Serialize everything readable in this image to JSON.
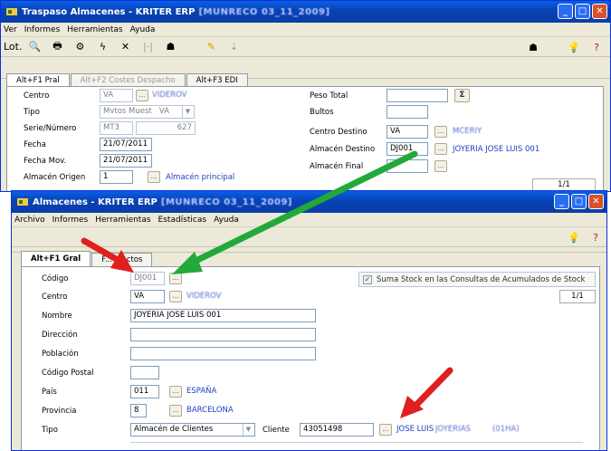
{
  "window1": {
    "title": "Traspaso Almacenes - KRITER ERP",
    "title_blur": "[MUNRECO 03_11_2009]",
    "menu": [
      "Ver",
      "Informes",
      "Herramientas",
      "Ayuda"
    ],
    "toolbar_label": "Lot.",
    "tabs": [
      "Alt+F1 Pral",
      "Alt+F2 Costes Despacho",
      "Alt+F3 EDI"
    ],
    "fields": {
      "centro_label": "Centro",
      "centro_value": "VA",
      "centro_link": "VIDEROV",
      "tipo_label": "Tipo",
      "tipo_value": "Mvtos Muest",
      "tipo_code": "VA",
      "serie_label": "Serie/Número",
      "serie_value": "MT3",
      "numero_value": "627",
      "fecha_label": "Fecha",
      "fecha_value": "21/07/2011",
      "fechamov_label": "Fecha Mov.",
      "fechamov_value": "21/07/2011",
      "almorigen_label": "Almacén Origen",
      "almorigen_value": "1",
      "almorigen_link": "Almacén principal",
      "peso_label": "Peso Total",
      "sigma": "Σ",
      "bultos_label": "Bultos",
      "centrodest_label": "Centro Destino",
      "centrodest_value": "VA",
      "centrodest_link": "MCERIY",
      "almdest_label": "Almacén Destino",
      "almdest_value": "DJ001",
      "almdest_link": "JOYERIA JOSE LUIS 001",
      "almfinal_label": "Almacén Final",
      "page": "1/1"
    }
  },
  "window2": {
    "title": "Almacenes - KRITER ERP",
    "title_blur": "[MUNRECO 03_11_2009]",
    "menu": [
      "Archivo",
      "Informes",
      "Herramientas",
      "Estadísticas",
      "Ayuda"
    ],
    "tabs": [
      "Alt+F1 Gral",
      "F... ...actos"
    ],
    "fields": {
      "codigo_label": "Código",
      "codigo_value": "DJ001",
      "centro_label": "Centro",
      "centro_value": "VA",
      "centro_link": "VIDEROV",
      "nombre_label": "Nombre",
      "nombre_value": "JOYERIA JOSE LUIS 001",
      "direccion_label": "Dirección",
      "poblacion_label": "Población",
      "cp_label": "Código Postal",
      "pais_label": "País",
      "pais_value": "011",
      "pais_link": "ESPAÑA",
      "provincia_label": "Provincia",
      "provincia_value": "8",
      "provincia_link": "BARCELONA",
      "tipo_label": "Tipo",
      "tipo_value": "Almacén de Clientes",
      "cliente_label": "Cliente",
      "cliente_value": "43051498",
      "cliente_link": "JOSE LUIS",
      "cliente_link_blur": "JOYERIAS",
      "cliente_link_blur2": "(01HA)",
      "suma_stock_label": "Suma Stock en las Consultas de Acumulados de Stock",
      "page": "1/1"
    }
  },
  "colors": {
    "arrow_green": "#22a93a",
    "arrow_red": "#e02020",
    "link": "#1f3fbf",
    "titlebar": "#0842b5"
  }
}
